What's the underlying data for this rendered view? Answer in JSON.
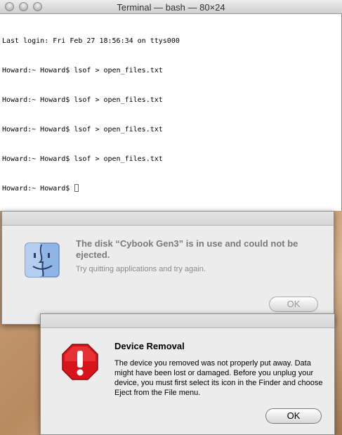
{
  "terminal": {
    "title": "Terminal — bash — 80×24",
    "lines": [
      "Last login: Fri Feb 27 18:56:34 on ttys000",
      "Howard:~ Howard$ lsof > open_files.txt",
      "Howard:~ Howard$ lsof > open_files.txt",
      "Howard:~ Howard$ lsof > open_files.txt",
      "Howard:~ Howard$ lsof > open_files.txt",
      "Howard:~ Howard$ "
    ]
  },
  "disk_alert": {
    "heading": "The disk “Cybook Gen3” is in use and could not be ejected.",
    "message": "Try quitting applications and try again.",
    "ok_label": "OK",
    "icon": "finder-icon"
  },
  "removal_alert": {
    "heading": "Device Removal",
    "message": "The device you removed was not properly put away. Data might have been lost or damaged. Before you unplug your device, you must first select its icon in the Finder and choose Eject from the File menu.",
    "ok_label": "OK",
    "icon": "stop-icon"
  },
  "colors": {
    "stop_red": "#d8141b",
    "finder_blue": "#8fb4e6"
  }
}
